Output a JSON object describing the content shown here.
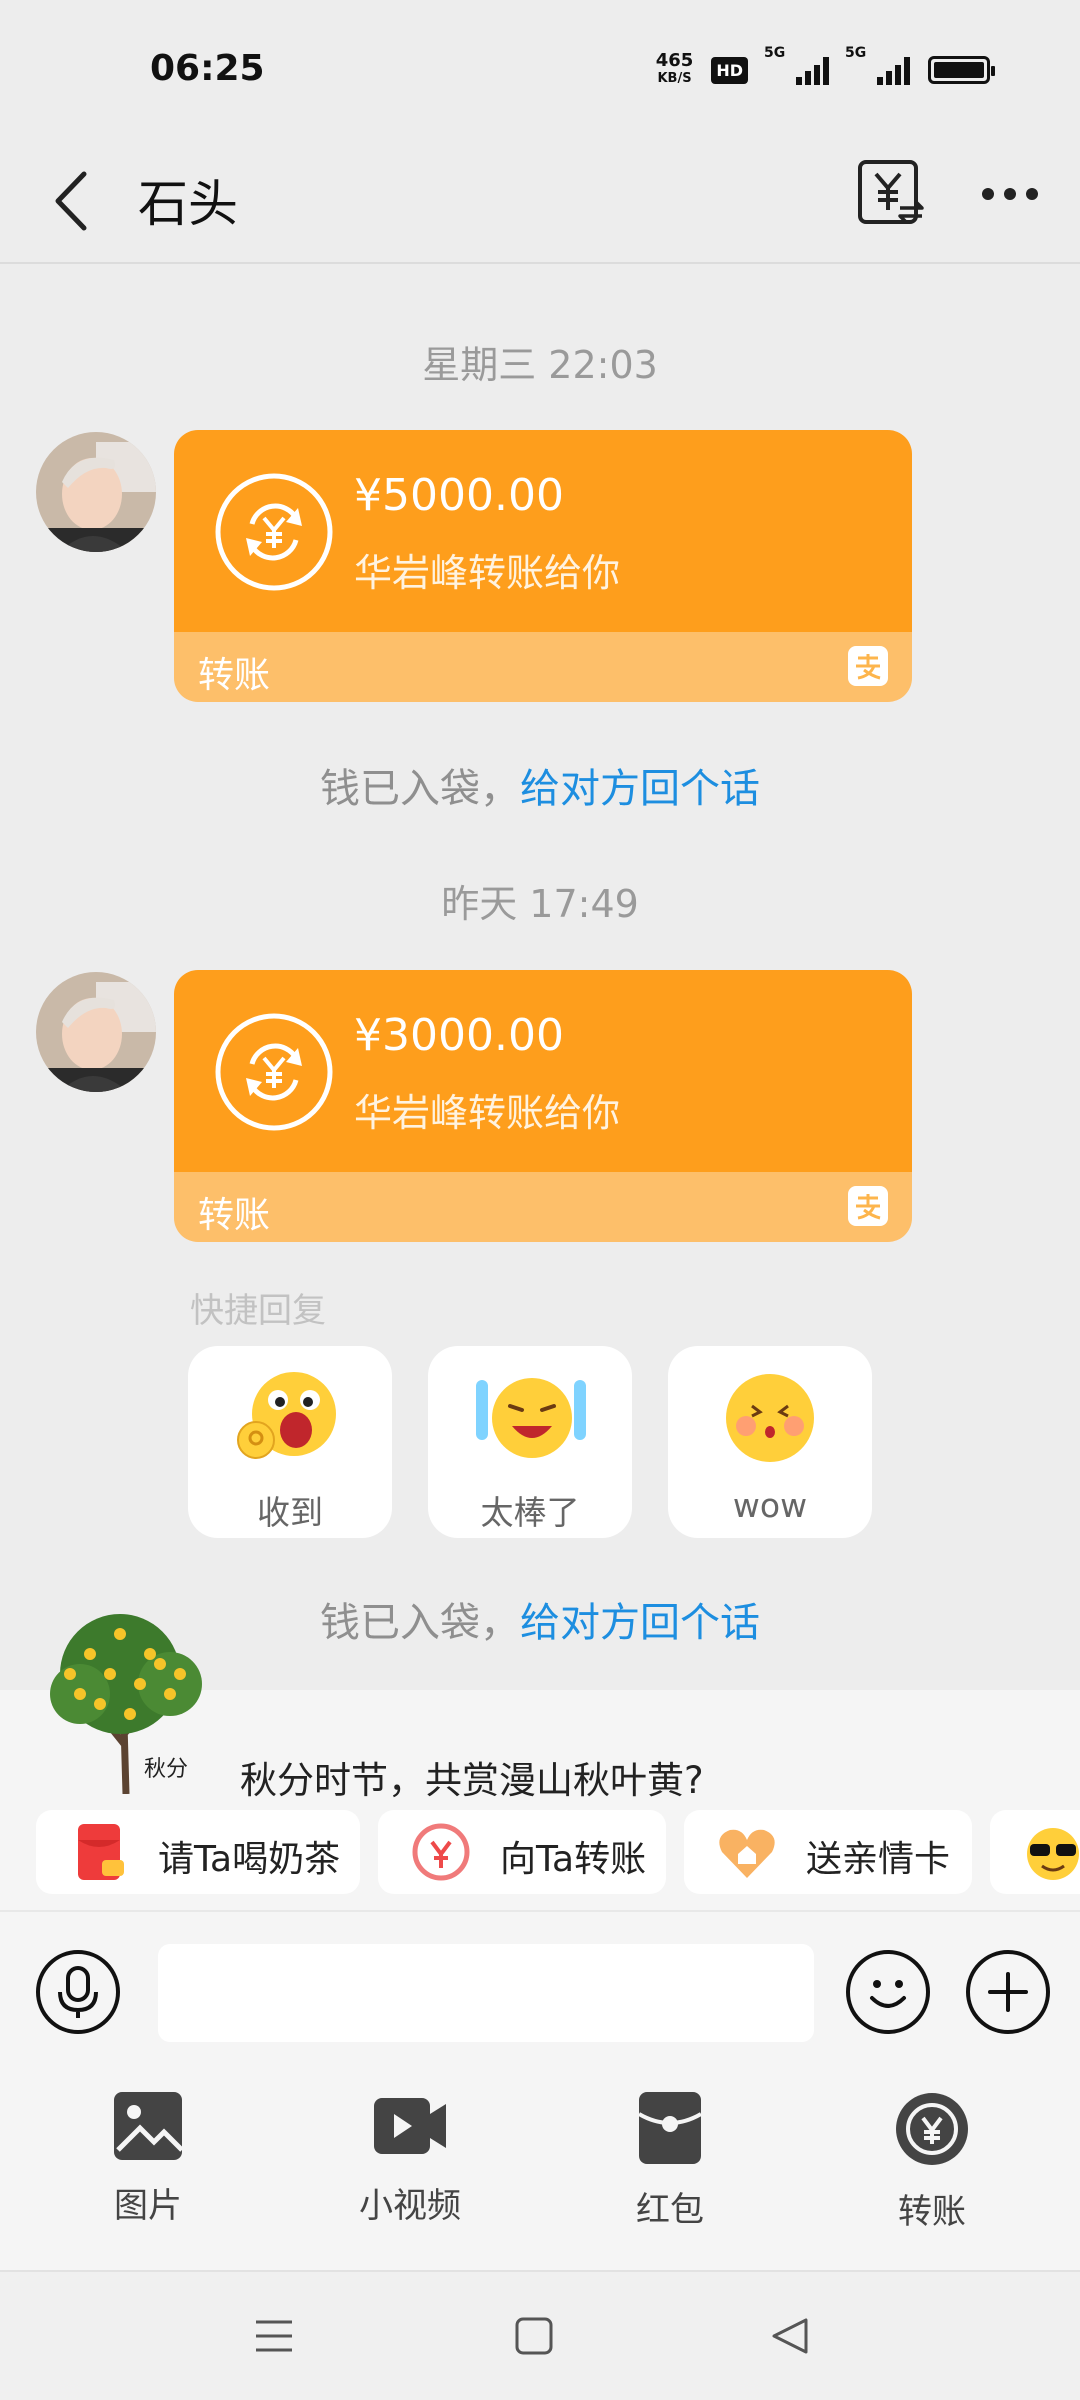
{
  "status": {
    "time": "06:25",
    "net_speed_value": "465",
    "net_speed_unit": "KB/S",
    "hd": "HD",
    "sim1": "5G",
    "sim2": "5G"
  },
  "header": {
    "title": "石头"
  },
  "messages": [
    {
      "timestamp": "星期三 22:03",
      "amount": "¥5000.00",
      "desc": "华岩峰转账给你",
      "label": "转账"
    },
    {
      "timestamp": "昨天 17:49",
      "amount": "¥3000.00",
      "desc": "华岩峰转账给你",
      "label": "转账"
    }
  ],
  "system_messages": [
    {
      "text": "钱已入袋，",
      "link": "给对方回个话"
    },
    {
      "text": "钱已入袋，",
      "link": "给对方回个话"
    }
  ],
  "quick_reply": {
    "title": "快捷回复",
    "items": [
      "收到",
      "太棒了",
      "wow"
    ]
  },
  "promo": {
    "tree_text": "秋分",
    "text": "秋分时节，共赏漫山秋叶黄?",
    "chips": [
      "请Ta喝奶茶",
      "向Ta转账",
      "送亲情卡"
    ]
  },
  "input": {
    "placeholder": ""
  },
  "tools": [
    "图片",
    "小视频",
    "红包",
    "转账"
  ],
  "colors": {
    "accent_orange": "#fe9e1c",
    "card_bottom": "#fdbf6a",
    "link_blue": "#1d8ee0"
  }
}
